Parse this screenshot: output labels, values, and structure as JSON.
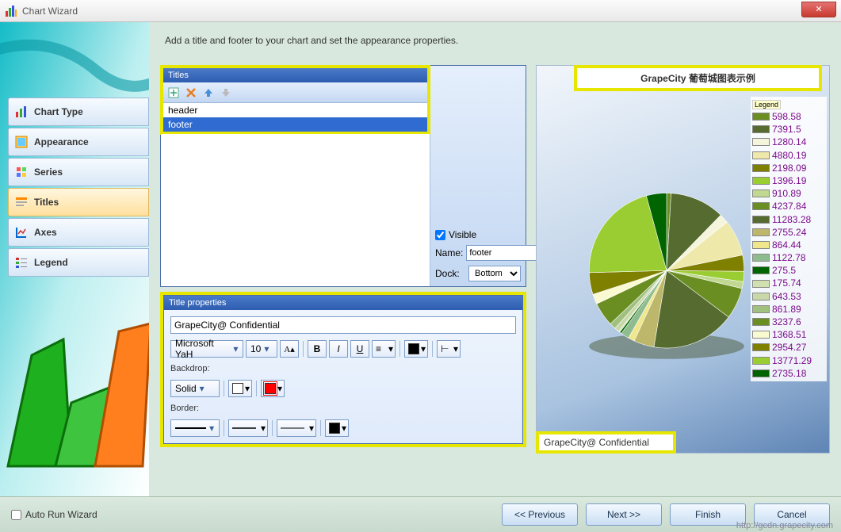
{
  "window": {
    "title": "Chart Wizard"
  },
  "instruction": "Add a title and footer to your chart and set the appearance properties.",
  "sidebar": {
    "items": [
      {
        "label": "Chart Type"
      },
      {
        "label": "Appearance"
      },
      {
        "label": "Series"
      },
      {
        "label": "Titles"
      },
      {
        "label": "Axes"
      },
      {
        "label": "Legend"
      }
    ]
  },
  "titles": {
    "header_label": "Titles",
    "items": [
      "header",
      "footer"
    ],
    "selected_index": 1,
    "visible_label": "Visible",
    "visible_checked": true,
    "name_label": "Name:",
    "name_value": "footer",
    "dock_label": "Dock:",
    "dock_value": "Bottom"
  },
  "props": {
    "header_label": "Title properties",
    "text_value": "GrapeCity@ Confidential",
    "font_family": "Microsoft YaH",
    "font_size": "10",
    "backdrop_label": "Backdrop:",
    "backdrop_style": "Solid",
    "backdrop_color1": "#ffffff",
    "backdrop_color2": "#ff0000",
    "border_label": "Border:",
    "border_color": "#000000",
    "text_color": "#000000"
  },
  "preview": {
    "title": "GrapeCity 葡萄城图表示例",
    "footer": "GrapeCity@ Confidential",
    "legend_header": "Legend"
  },
  "chart_data": {
    "type": "pie",
    "title": "GrapeCity 葡萄城图表示例",
    "series": [
      {
        "value": 598.58,
        "color": "#6b8e23"
      },
      {
        "value": 7391.5,
        "color": "#556b2f"
      },
      {
        "value": 1280.14,
        "color": "#f5f5dc"
      },
      {
        "value": 4880.19,
        "color": "#eee8aa"
      },
      {
        "value": 2198.09,
        "color": "#808000"
      },
      {
        "value": 1396.19,
        "color": "#9acd32"
      },
      {
        "value": 910.89,
        "color": "#c0d890"
      },
      {
        "value": 4237.84,
        "color": "#6b8e23"
      },
      {
        "value": 11283.28,
        "color": "#556b2f"
      },
      {
        "value": 2755.24,
        "color": "#bdb76b"
      },
      {
        "value": 864.44,
        "color": "#f0e68c"
      },
      {
        "value": 1122.78,
        "color": "#8fbc8f"
      },
      {
        "value": 275.5,
        "color": "#006400"
      },
      {
        "value": 175.74,
        "color": "#d2e0b0"
      },
      {
        "value": 643.53,
        "color": "#c8d8a8"
      },
      {
        "value": 861.89,
        "color": "#a0c080"
      },
      {
        "value": 3237.6,
        "color": "#6b8e23"
      },
      {
        "value": 1368.51,
        "color": "#fafad2"
      },
      {
        "value": 2954.27,
        "color": "#808000"
      },
      {
        "value": 13771.29,
        "color": "#9acd32"
      },
      {
        "value": 2735.18,
        "color": "#006400"
      }
    ]
  },
  "bottom": {
    "auto_run": "Auto Run Wizard",
    "previous": "<<  Previous",
    "next": "Next >>",
    "finish": "Finish",
    "cancel": "Cancel"
  },
  "watermark": "http://gcdn.grapecity.com"
}
